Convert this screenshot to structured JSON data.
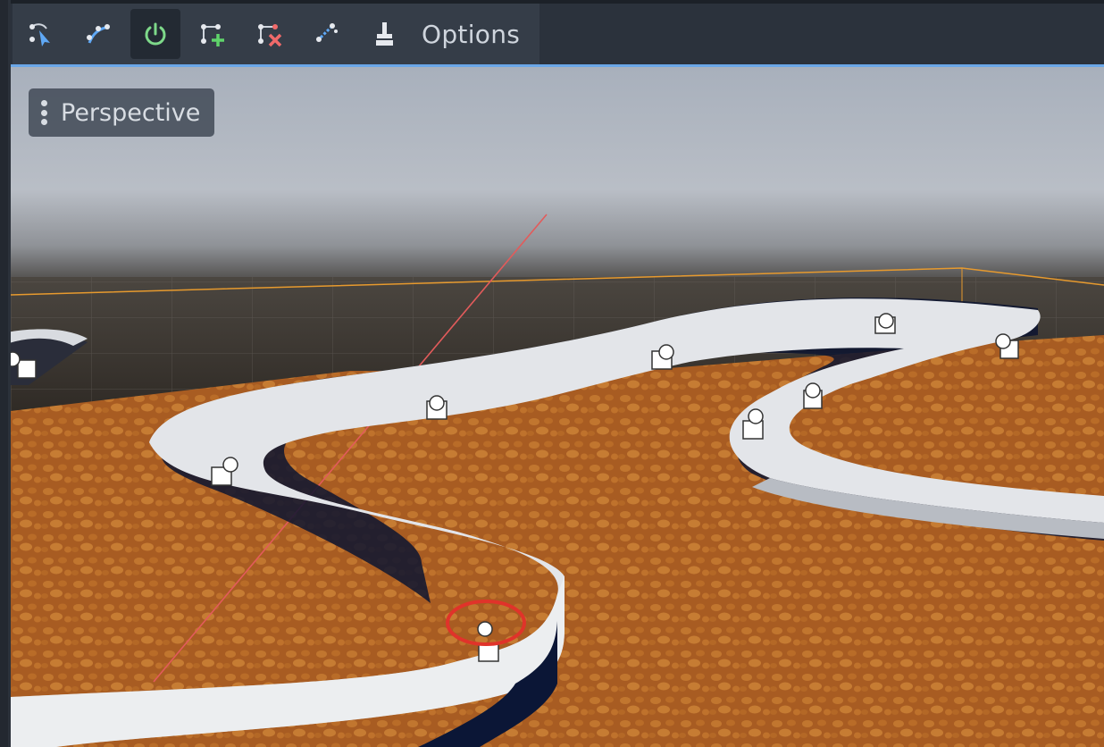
{
  "toolbar": {
    "buttons": [
      {
        "name": "select-points",
        "icon": "curve-select-icon",
        "active": false
      },
      {
        "name": "select-control-points",
        "icon": "curve-control-icon",
        "active": false
      },
      {
        "name": "close-curve",
        "icon": "power-icon",
        "active": true
      },
      {
        "name": "add-point",
        "icon": "curve-add-point-icon",
        "active": false
      },
      {
        "name": "delete-point",
        "icon": "curve-delete-point-icon",
        "active": false
      },
      {
        "name": "close-path",
        "icon": "curve-close-icon",
        "active": false
      },
      {
        "name": "clear-points",
        "icon": "broom-icon",
        "active": false
      }
    ],
    "options_label": "Options"
  },
  "viewport": {
    "view_label": "Perspective",
    "colors": {
      "accent": "#6aa7e8",
      "active_icon": "#7ed98a",
      "add_icon": "#5fd46a",
      "delete_icon": "#f06a6a",
      "highlight_ring": "#e0332a"
    }
  }
}
